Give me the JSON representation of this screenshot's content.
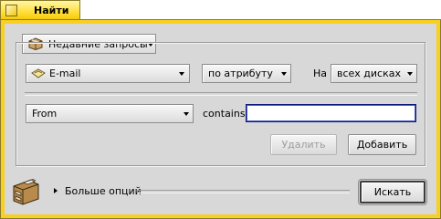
{
  "window": {
    "title": "Найти"
  },
  "recent_queries": {
    "label": "Недавние запросы"
  },
  "criteria": {
    "file_type": "E-mail",
    "search_by": "по атрибуту",
    "volume_label": "На",
    "volume": "всех дисках"
  },
  "attribute_row": {
    "attribute": "From",
    "operator": "contains",
    "value": ""
  },
  "buttons": {
    "remove": "Удалить",
    "add": "Добавить",
    "search": "Искать"
  },
  "more_options": {
    "label": "Больше опций",
    "expanded": false
  },
  "colors": {
    "tab_yellow": "#ffe040",
    "frame_yellow": "#f8d020",
    "panel_gray": "#d8d8d8",
    "input_border": "#0c1a7a"
  }
}
